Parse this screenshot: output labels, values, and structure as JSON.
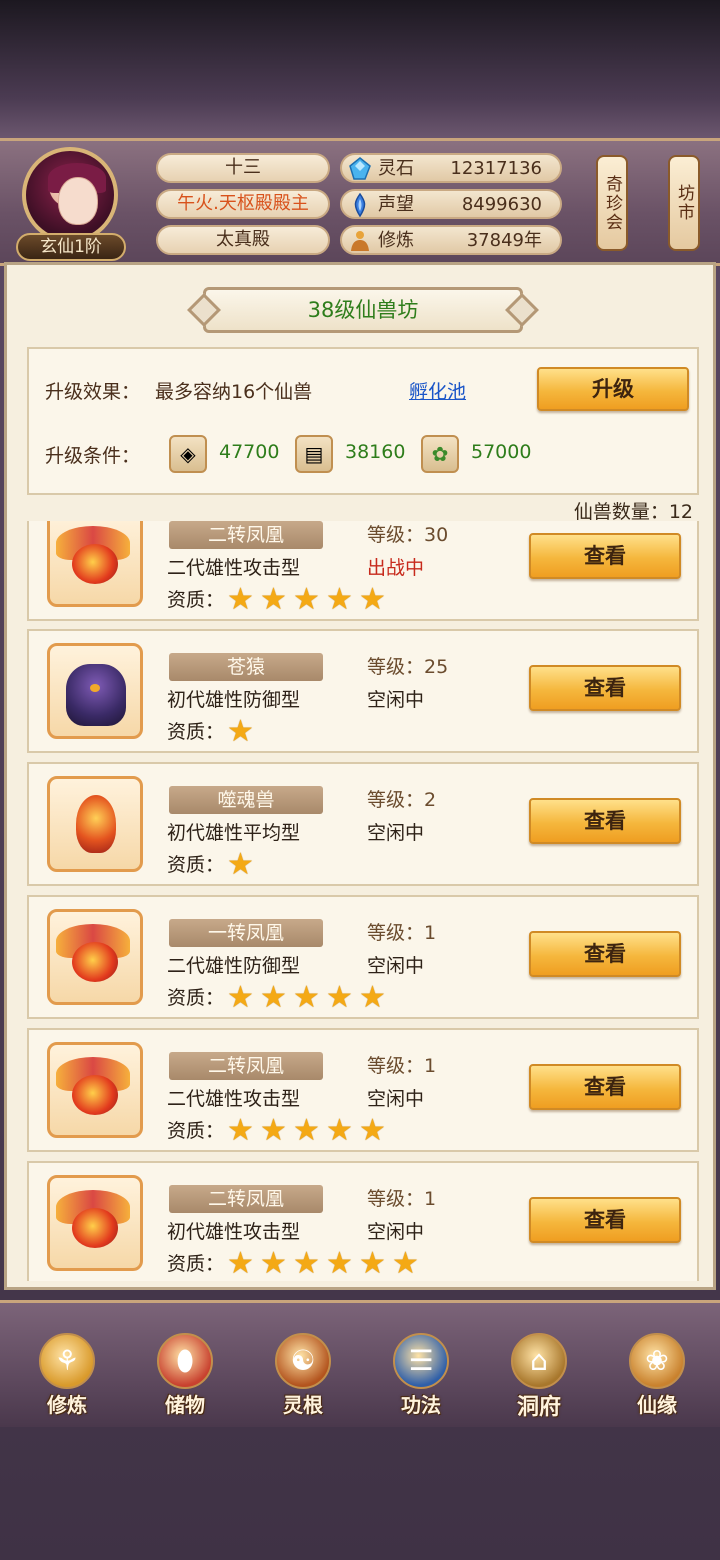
{
  "player": {
    "rank": "玄仙1阶",
    "name": "十三",
    "title": "午火.天枢殿殿主",
    "sect": "太真殿"
  },
  "resources": [
    {
      "name": "灵石",
      "value": "12317136",
      "icon": "spirit-stone-icon"
    },
    {
      "name": "声望",
      "value": "8499630",
      "icon": "prestige-icon"
    },
    {
      "name": "修炼",
      "value": "37849年",
      "icon": "cultivation-icon"
    }
  ],
  "side_buttons": {
    "treasure": "奇珍会",
    "market": "坊市"
  },
  "panel": {
    "title": "38级仙兽坊",
    "upgrade_effect_label": "升级效果：",
    "upgrade_effect_value": "最多容纳16个仙兽",
    "hatch_link": "孵化池",
    "upgrade_button": "升级",
    "upgrade_cond_label": "升级条件：",
    "materials": [
      {
        "icon": "ore-icon",
        "value": "47700"
      },
      {
        "icon": "wood-icon",
        "value": "38160"
      },
      {
        "icon": "herb-icon",
        "value": "57000"
      }
    ],
    "pet_count_label": "仙兽数量：12"
  },
  "pets": [
    {
      "name": "二转凤凰",
      "level": "等级：30",
      "type": "二代雄性攻击型",
      "status": "出战中",
      "battle": true,
      "stars": 5,
      "kind": "phoenix"
    },
    {
      "name": "苍猿",
      "level": "等级：25",
      "type": "初代雄性防御型",
      "status": "空闲中",
      "battle": false,
      "stars": 1,
      "kind": "ape"
    },
    {
      "name": "噬魂兽",
      "level": "等级：2",
      "type": "初代雄性平均型",
      "status": "空闲中",
      "battle": false,
      "stars": 1,
      "kind": "soul"
    },
    {
      "name": "一转凤凰",
      "level": "等级：1",
      "type": "二代雄性防御型",
      "status": "空闲中",
      "battle": false,
      "stars": 5,
      "kind": "phoenix"
    },
    {
      "name": "二转凤凰",
      "level": "等级：1",
      "type": "二代雄性攻击型",
      "status": "空闲中",
      "battle": false,
      "stars": 5,
      "kind": "phoenix"
    },
    {
      "name": "二转凤凰",
      "level": "等级：1",
      "type": "初代雄性攻击型",
      "status": "空闲中",
      "battle": false,
      "stars": 6,
      "kind": "phoenix"
    }
  ],
  "quality_label": "资质：",
  "view_label": "查看",
  "nav": [
    {
      "label": "修炼",
      "icon": "cultivate-icon",
      "color": "#d99a2b"
    },
    {
      "label": "储物",
      "icon": "storage-bag-icon",
      "color": "#c8412f"
    },
    {
      "label": "灵根",
      "icon": "spirit-root-icon",
      "color": "#b3541e"
    },
    {
      "label": "功法",
      "icon": "scripture-book-icon",
      "color": "#2f5fa8"
    },
    {
      "label": "洞府",
      "icon": "cave-palace-icon",
      "color": "#a8772c"
    },
    {
      "label": "仙缘",
      "icon": "gourd-icon",
      "color": "#c9822e"
    }
  ]
}
